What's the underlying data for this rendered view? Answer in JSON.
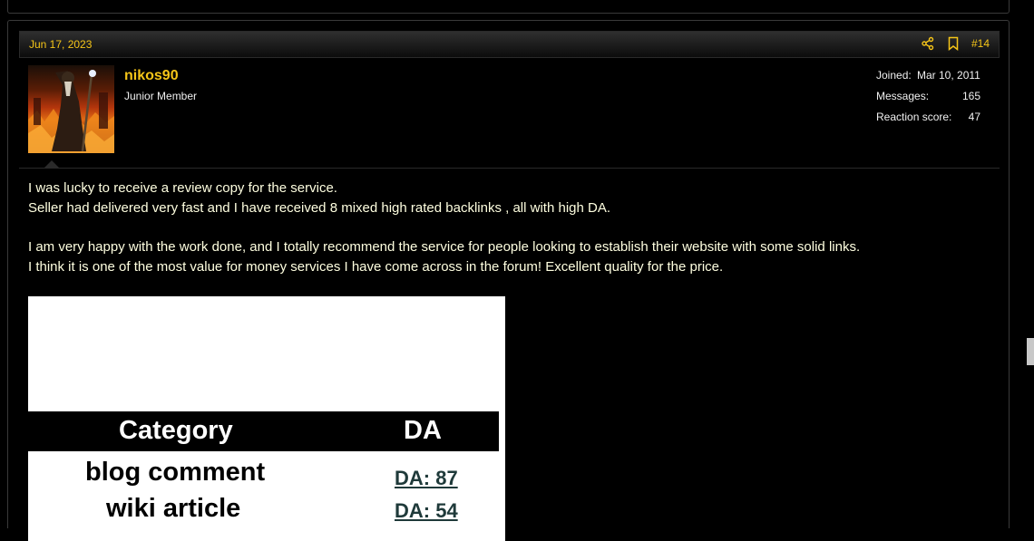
{
  "post": {
    "date": "Jun 17, 2023",
    "number": "#14",
    "author": {
      "username": "nikos90",
      "title": "Junior Member"
    },
    "stats": [
      {
        "label": "Joined:",
        "value": "Mar 10, 2011"
      },
      {
        "label": "Messages:",
        "value": "165"
      },
      {
        "label": "Reaction score:",
        "value": "47"
      }
    ],
    "message": {
      "lines": [
        "I was lucky to receive a review copy for the service.",
        "Seller had delivered very fast and I have received 8 mixed high rated backlinks , all with high DA.",
        "I am very happy with the work done, and I totally recommend the service for people looking to establish their website with some solid links.",
        "I think it is one of the most value for money services I have come across in the forum! Excellent quality for the price."
      ]
    },
    "image_table": {
      "headers": [
        "Category",
        "DA"
      ],
      "rows": [
        {
          "category": "blog comment",
          "da": "DA: 87"
        },
        {
          "category": "wiki article",
          "da": "DA: 54"
        }
      ]
    }
  },
  "icons": {
    "share": "share-icon",
    "bookmark": "bookmark-icon"
  },
  "colors": {
    "accent": "#f5c518",
    "text": "#ffffe0",
    "background": "#000000"
  }
}
